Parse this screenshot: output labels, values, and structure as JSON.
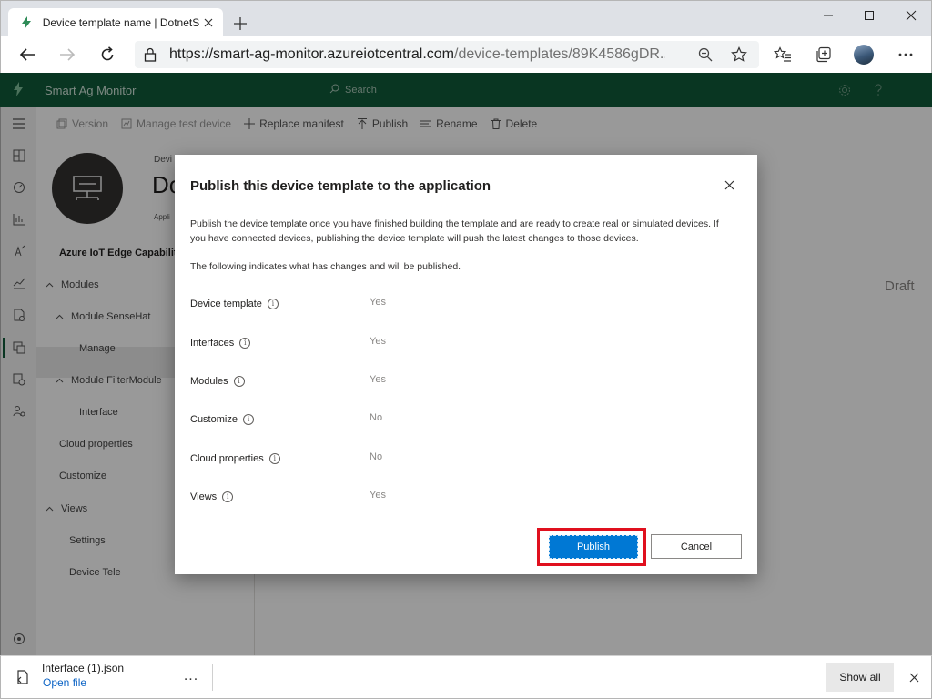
{
  "browser": {
    "tab_title": "Device template name | DotnetS",
    "url_host": "https://smart-ag-monitor.azureiotcentral.com",
    "url_path": "/device-templates/89K4586gDR..."
  },
  "app": {
    "name": "Smart Ag Monitor",
    "search_placeholder": "Search",
    "header_color": "#0f5a3a"
  },
  "command_bar": {
    "version": "Version",
    "manage_test_device": "Manage test device",
    "replace_manifest": "Replace manifest",
    "publish": "Publish",
    "rename": "Rename",
    "delete": "Delete"
  },
  "template_header": {
    "small_label": "Devi",
    "big_label": "Do",
    "applied_label": "Appli"
  },
  "tree": {
    "heading": "Azure IoT Edge Capability",
    "items": [
      {
        "label": "Modules"
      },
      {
        "label": "Module SenseHat"
      },
      {
        "label": "Manage"
      },
      {
        "label": "Module FilterModule"
      },
      {
        "label": "Interface"
      },
      {
        "label": "Cloud properties"
      },
      {
        "label": "Customize"
      },
      {
        "label": "Views"
      },
      {
        "label": "Settings"
      },
      {
        "label": "Device Tele"
      }
    ]
  },
  "status": {
    "draft": "Draft"
  },
  "dialog": {
    "title": "Publish this device template to the application",
    "description": "Publish the device template once you have finished building the template and are ready to create real or simulated devices. If you have connected devices, publishing the device template will push the latest changes to those devices.",
    "note": "The following indicates what has changes and will be published.",
    "changes": [
      {
        "label": "Device template",
        "value": "Yes"
      },
      {
        "label": "Interfaces",
        "value": "Yes"
      },
      {
        "label": "Modules",
        "value": "Yes"
      },
      {
        "label": "Customize",
        "value": "No"
      },
      {
        "label": "Cloud properties",
        "value": "No"
      },
      {
        "label": "Views",
        "value": "Yes"
      }
    ],
    "publish_label": "Publish",
    "cancel_label": "Cancel",
    "primary_color": "#0078d4",
    "highlight_color": "#e0101e"
  },
  "download_bar": {
    "file_name": "Interface (1).json",
    "open_file": "Open file",
    "more": "...",
    "show_all": "Show all"
  }
}
